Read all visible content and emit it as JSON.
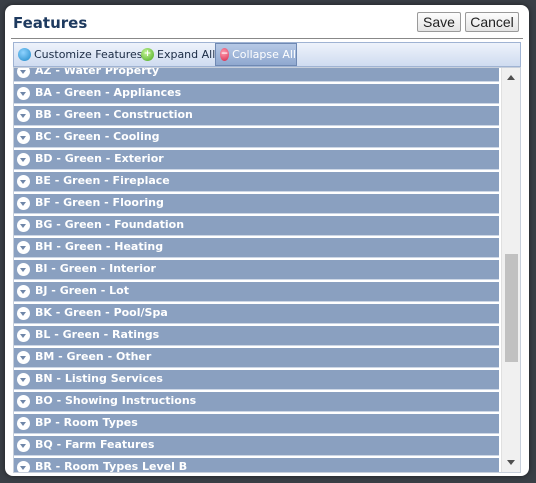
{
  "header": {
    "title": "Features",
    "save_label": "Save",
    "cancel_label": "Cancel"
  },
  "toolbar": {
    "customize_label": "Customize Features",
    "expand_label": "Expand All",
    "collapse_label": "Collapse All"
  },
  "features": {
    "items": [
      "AZ - Water Property",
      "BA - Green - Appliances",
      "BB - Green - Construction",
      "BC - Green - Cooling",
      "BD - Green - Exterior",
      "BE - Green - Fireplace",
      "BF - Green - Flooring",
      "BG - Green - Foundation",
      "BH - Green - Heating",
      "BI - Green - Interior",
      "BJ - Green - Lot",
      "BK - Green - Pool/Spa",
      "BL - Green - Ratings",
      "BM - Green - Other",
      "BN - Listing Services",
      "BO - Showing Instructions",
      "BP - Room Types",
      "BQ - Farm Features",
      "BR - Room Types Level B"
    ]
  },
  "colors": {
    "row_bg": "#8aa0c0",
    "title": "#1e3a5f"
  }
}
